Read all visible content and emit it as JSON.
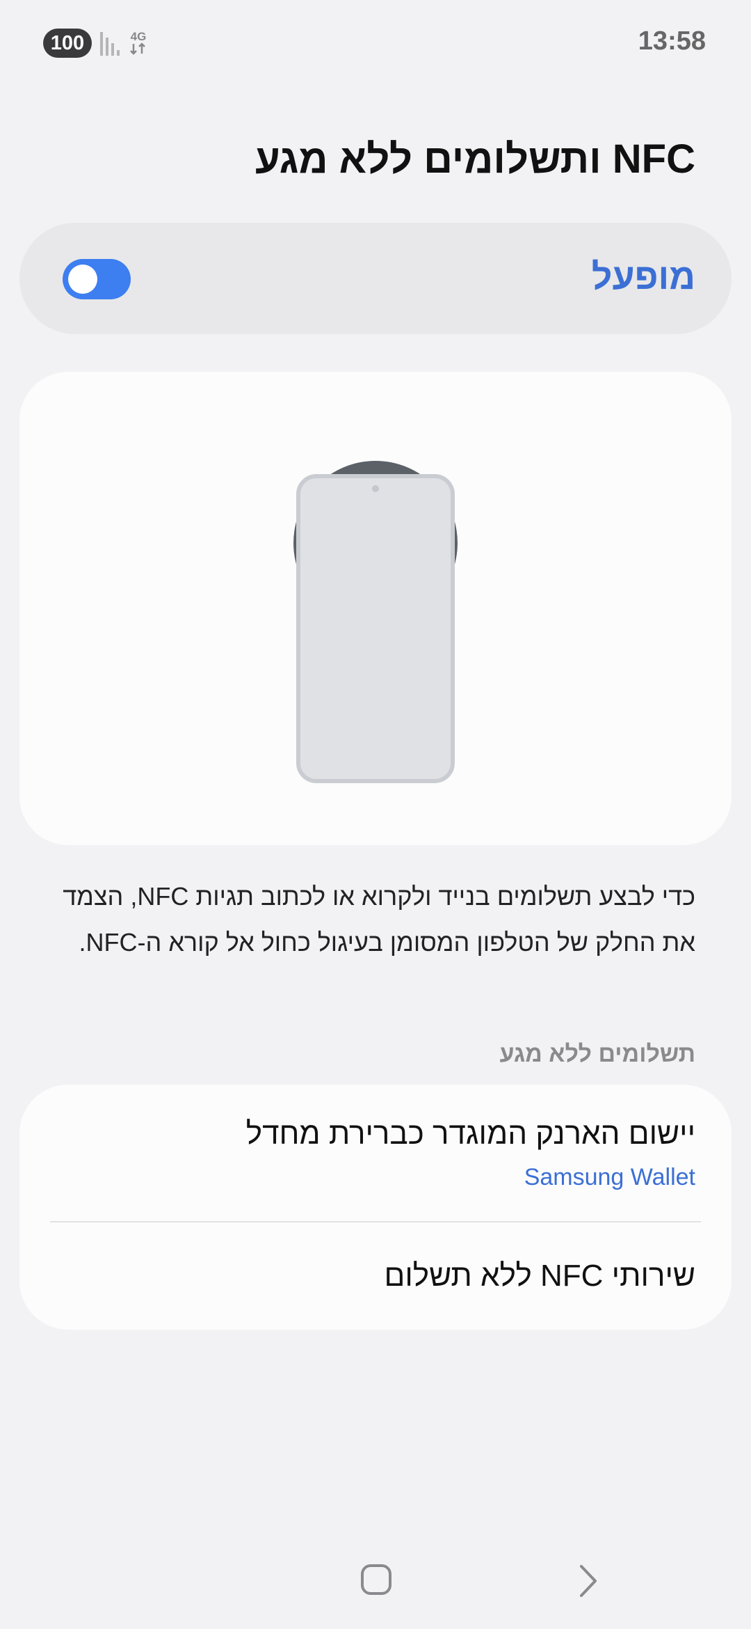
{
  "status_bar": {
    "battery": "100",
    "network": "4G",
    "time": "13:58",
    "icons": [
      "battery-badge",
      "signal-icon",
      "4g-data-icon"
    ]
  },
  "page": {
    "title": "NFC ותשלומים ללא מגע"
  },
  "master_toggle": {
    "label": "מופעל",
    "on": true,
    "accent_color": "#3d7ef0",
    "label_color": "#3b6fd4"
  },
  "illustration": {
    "icons": [
      "phone-illustration",
      "nfc-reader-circle"
    ]
  },
  "description": "כדי לבצע תשלומים בנייד ולקרוא או לכתוב תגיות NFC, הצמד את החלק של הטלפון המסומן בעיגול כחול אל קורא ה-NFC.",
  "contactless_section": {
    "header": "תשלומים ללא מגע",
    "items": [
      {
        "title": "יישום הארנק המוגדר כברירת מחדל",
        "subtitle": "Samsung Wallet"
      },
      {
        "title": "שירותי NFC ללא תשלום"
      }
    ]
  },
  "nav_bar": {
    "icons": [
      "home-icon",
      "back-icon"
    ]
  }
}
